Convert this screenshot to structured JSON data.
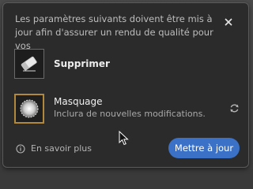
{
  "dialog": {
    "message": "Les paramètres suivants doivent être mis à jour afin d'assurer un rendu de qualité pour vos",
    "close_icon": "close-icon"
  },
  "items": [
    {
      "title": "Supprimer",
      "subtitle": "",
      "icon": "eraser-icon"
    },
    {
      "title": "Masquage",
      "subtitle": "Inclura de nouvelles modifications.",
      "icon": "radial-mask-icon",
      "status_icon": "sync-icon"
    }
  ],
  "footer": {
    "learn_more": "En savoir plus",
    "learn_more_icon": "info-icon",
    "update_button": "Mettre à jour"
  },
  "colors": {
    "accent": "#3b72c7",
    "selection_border": "#b08a3a",
    "background": "#2b2b2b"
  }
}
